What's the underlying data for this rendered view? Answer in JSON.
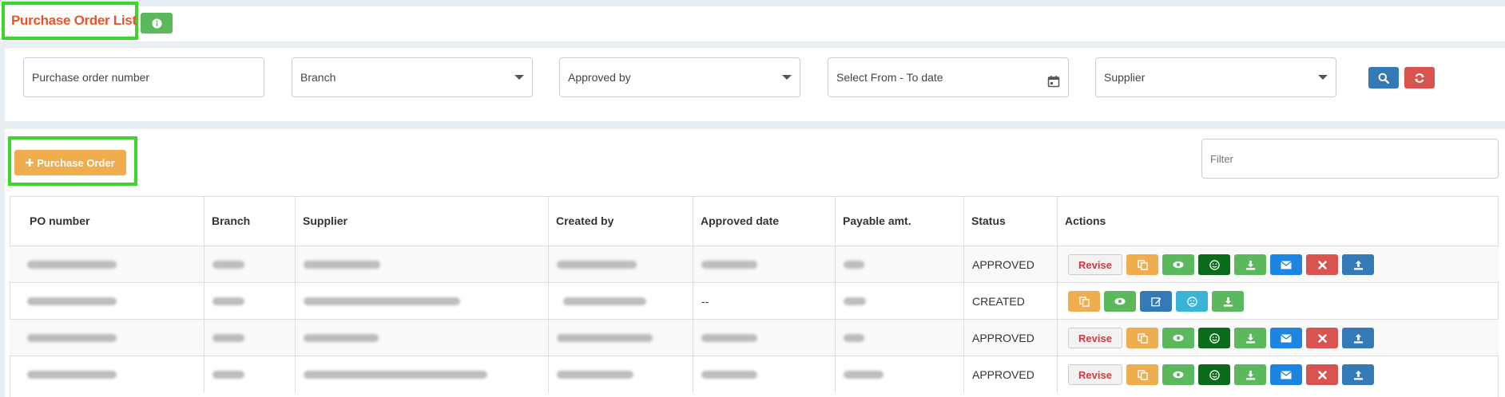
{
  "header": {
    "title": "Purchase Order List",
    "info_icon": "info-circle-icon"
  },
  "filters": {
    "po_number_placeholder": "Purchase order number",
    "branch_placeholder": "Branch",
    "approved_by_placeholder": "Approved by",
    "date_placeholder": "Select From - To date",
    "supplier_placeholder": "Supplier",
    "search_icon": "search-icon",
    "reset_icon": "refresh-icon"
  },
  "toolbar": {
    "add_label": "Purchase Order",
    "filter_placeholder": "Filter"
  },
  "table": {
    "columns": [
      "PO number",
      "Branch",
      "Supplier",
      "Created by",
      "Approved date",
      "Payable amt.",
      "Status",
      "Actions"
    ],
    "rows": [
      {
        "approved_date": "",
        "status": "APPROVED",
        "revise_label": "Revise"
      },
      {
        "approved_date": "--",
        "status": "CREATED"
      },
      {
        "approved_date": "",
        "status": "APPROVED",
        "revise_label": "Revise"
      },
      {
        "approved_date": "",
        "status": "APPROVED",
        "revise_label": "Revise"
      }
    ]
  },
  "colors": {
    "title": "#e4572e",
    "highlight": "#3ad62a",
    "primary": "#337ab7",
    "success": "#5cb85c",
    "warning": "#f0ad4e",
    "danger": "#d9534f"
  }
}
